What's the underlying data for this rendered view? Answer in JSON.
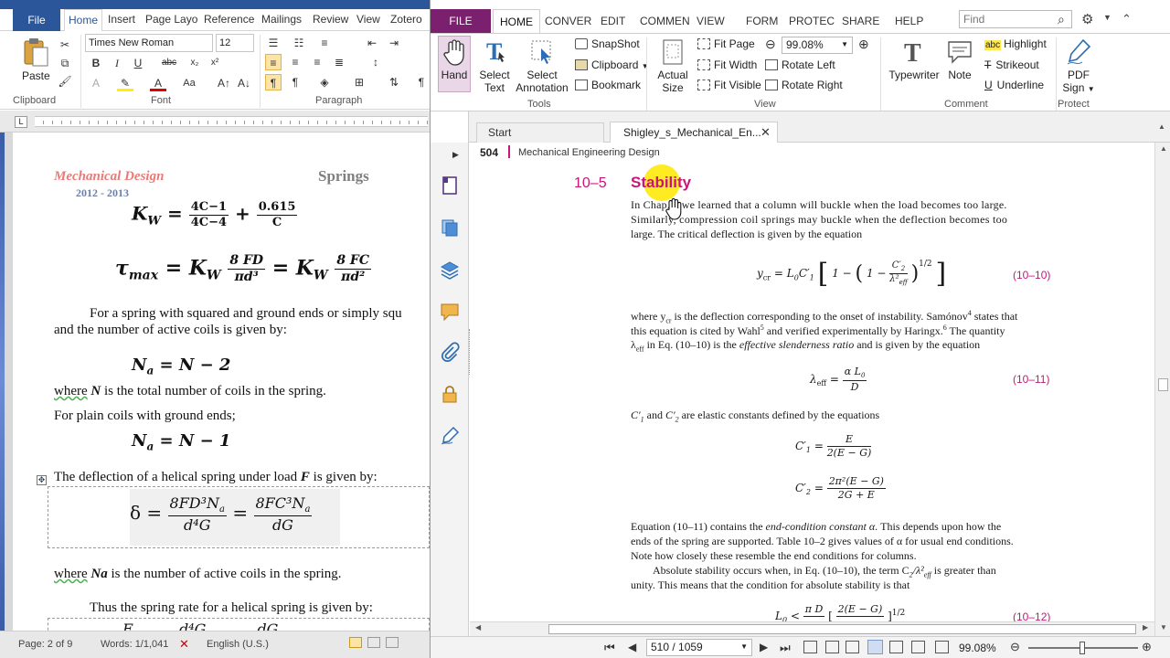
{
  "word": {
    "tabs": {
      "file": "File",
      "home": "Home",
      "insert": "Insert",
      "page_layout": "Page Layo",
      "references": "Reference",
      "mailings": "Mailings",
      "review": "Review",
      "view": "View",
      "zotero": "Zotero"
    },
    "ribbon": {
      "paste": "Paste",
      "font_name": "Times New Roman",
      "font_size": "12",
      "groups": {
        "clipboard": "Clipboard",
        "font": "Font",
        "paragraph": "Paragraph"
      }
    },
    "doc": {
      "header_left": "Mechanical Design",
      "header_right": "Springs",
      "header_year": "2012 - 2013",
      "p1a": "For a spring with squared and ground ends or simply squ",
      "p1b": "and the number of active coils is given by:",
      "p2_where": "where",
      "p2_rest": " is the total number of coils in the spring.",
      "p2_var": "N",
      "p3": "For plain coils with ground ends;",
      "p4a": "The deflection of a helical spring under load ",
      "p4_var": "F",
      "p4b": " is given by:",
      "p5_where": "where",
      "p5_var": "Na",
      "p5_rest": " is the number of active coils in the spring.",
      "p6": "Thus the spring rate for a helical spring is given by:"
    },
    "status": {
      "page": "Page: 2 of 9",
      "words": "Words: 1/1,041",
      "language": "English (U.S.)"
    }
  },
  "pdf": {
    "tabs": {
      "file": "FILE",
      "home": "HOME",
      "convert": "CONVER",
      "edit": "EDIT",
      "comment": "COMMEN",
      "view": "VIEW",
      "form": "FORM",
      "protect": "PROTEC",
      "share": "SHARE",
      "help": "HELP"
    },
    "find_placeholder": "Find",
    "ribbon": {
      "hand": "Hand",
      "select_text_1": "Select",
      "select_text_2": "Text",
      "select_ann_1": "Select",
      "select_ann_2": "Annotation",
      "snapshot": "SnapShot",
      "clipboard": "Clipboard",
      "bookmark": "Bookmark",
      "actual_1": "Actual",
      "actual_2": "Size",
      "fit_page": "Fit Page",
      "fit_width": "Fit Width",
      "fit_visible": "Fit Visible",
      "zoom": "99.08%",
      "rotate_left": "Rotate Left",
      "rotate_right": "Rotate Right",
      "typewriter": "Typewriter",
      "note": "Note",
      "highlight": "Highlight",
      "strikeout": "Strikeout",
      "underline": "Underline",
      "pdf_sign_1": "PDF",
      "pdf_sign_2": "Sign",
      "groups": {
        "tools": "Tools",
        "view": "View",
        "comment": "Comment",
        "protect": "Protect"
      }
    },
    "doc_tabs": {
      "start": "Start",
      "current": "Shigley_s_Mechanical_En..."
    },
    "page": {
      "page_number": "504",
      "running_head": "Mechanical Engineering Design",
      "section_number": "10–5",
      "section_title": "Stability",
      "para1_l1": "In Chap. 4 we learned that a column will buckle when the load becomes too large.",
      "para1_l2": "Similarly, compression coil springs may buckle when the deflection becomes too",
      "para1_l3": "large. The critical deflection is given by the equation",
      "eq1_num": "(10–10)",
      "para2_l1": "where y",
      "para2_l1b": "cr",
      "para2_l1c": " is the deflection corresponding to the onset of instability. Samónov",
      "para2_l1d": "4",
      "para2_l1e": " states that",
      "para2_l2": "this equation is cited by Wahl",
      "para2_l2b": "5",
      "para2_l2c": " and verified experimentally by Haringx.",
      "para2_l2d": "6",
      "para2_l2e": " The quantity",
      "para2_l3a": "λ",
      "para2_l3b": "eff",
      "para2_l3c": " in Eq. (10–10) is the ",
      "para2_l3d": "effective slenderness ratio",
      "para2_l3e": " and is given by the equation",
      "eq2_num": "(10–11)",
      "para3": " are elastic constants defined by the equations",
      "para3_and": "and",
      "para4_l1a": "Equation (10–11) contains the ",
      "para4_l1b": "end-condition constant α",
      "para4_l1c": ". This depends upon how the",
      "para4_l2": "ends of the spring are supported. Table 10–2 gives values of α for usual end conditions.",
      "para4_l3": "Note how closely these resemble the end conditions for columns.",
      "para5_l1a": "Absolute stability occurs when, in Eq. (10–10), the term C",
      "para5_l1b": " is greater than",
      "para5_l2": "unity. This means that the condition for absolute stability is that",
      "eq3_num": "(10–12)"
    },
    "status": {
      "page": "510 / 1059",
      "zoom": "99.08%"
    }
  }
}
